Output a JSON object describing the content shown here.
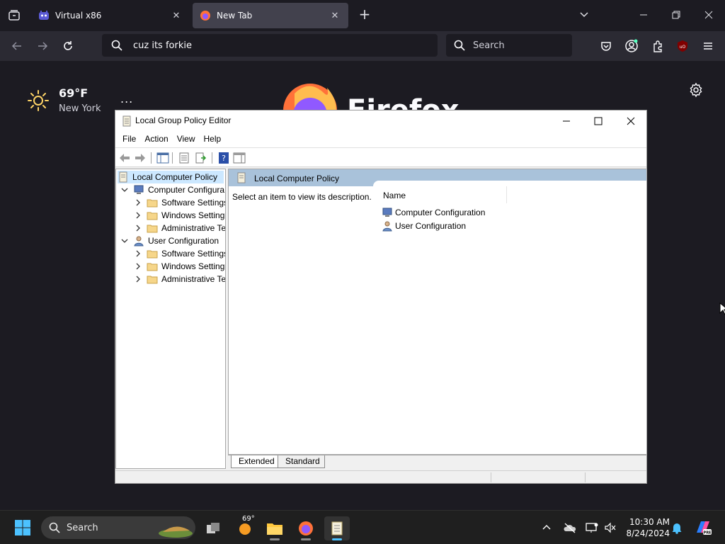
{
  "browser": {
    "tabs": [
      {
        "title": "Virtual x86",
        "active": false
      },
      {
        "title": "New Tab",
        "active": true
      }
    ],
    "url": "cuz its forkie",
    "search_placeholder": "Search",
    "accent": "#fbfbfe"
  },
  "newtab": {
    "weather": {
      "temp": "69°F",
      "city": "New York",
      "more": "..."
    },
    "brand_word": "Firefox"
  },
  "gpedit": {
    "title": "Local Group Policy Editor",
    "menu": [
      "File",
      "Action",
      "Help",
      "View"
    ],
    "menu_order": {
      "file": "File",
      "action": "Action",
      "view": "View",
      "help": "Help"
    },
    "tree": {
      "root": "Local Computer Policy",
      "computer": "Computer Configura",
      "computer_children": [
        "Software Settings",
        "Windows Setting",
        "Administrative Te"
      ],
      "user": "User Configuration",
      "user_children": [
        "Software Settings",
        "Windows Setting",
        "Administrative Te"
      ]
    },
    "right": {
      "header": "Local Computer Policy",
      "description": "Select an item to view its description.",
      "column_name": "Name",
      "rows": [
        "Computer Configuration",
        "User Configuration"
      ]
    },
    "tabs": {
      "extended": "Extended",
      "standard": "Standard"
    }
  },
  "taskbar": {
    "search_label": "Search",
    "weather_badge": "69°",
    "time": "10:30 AM",
    "date": "8/24/2024"
  }
}
